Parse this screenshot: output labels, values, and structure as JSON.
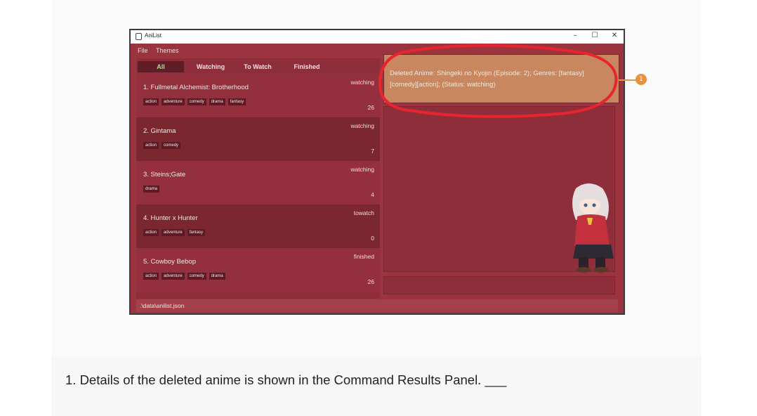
{
  "window": {
    "title": "AniList",
    "minimize": "–",
    "maximize": "☐",
    "close": "✕"
  },
  "menu": {
    "file": "File",
    "themes": "Themes"
  },
  "tabs": [
    {
      "label": "All",
      "active": true
    },
    {
      "label": "Watching",
      "active": false
    },
    {
      "label": "To Watch",
      "active": false
    },
    {
      "label": "Finished",
      "active": false
    }
  ],
  "anime_list": [
    {
      "name": "1.  Fullmetal Alchemist: Brotherhood",
      "tags": [
        "action",
        "adventure",
        "comedy",
        "drama",
        "fantasy"
      ],
      "status": "watching",
      "episode": "26"
    },
    {
      "name": "2.  Gintama",
      "tags": [
        "action",
        "comedy"
      ],
      "status": "watching",
      "episode": "7"
    },
    {
      "name": "3.  Steins;Gate",
      "tags": [
        "drama"
      ],
      "status": "watching",
      "episode": "4"
    },
    {
      "name": "4.  Hunter x Hunter",
      "tags": [
        "action",
        "adventure",
        "fantasy"
      ],
      "status": "towatch",
      "episode": "0"
    },
    {
      "name": "5.  Cowboy Bebop",
      "tags": [
        "action",
        "adventure",
        "comedy",
        "drama"
      ],
      "status": "finished",
      "episode": "26"
    }
  ],
  "result": {
    "text": "Deleted Anime: Shingeki no Kyojin (Episode: 2); Genres: [fantasy][comedy][action]; (Status: watching)"
  },
  "statusbar": {
    "path": ".\\data\\anilist.json"
  },
  "callout": {
    "number": "1"
  },
  "caption": {
    "text": "1. Details of the deleted anime is shown in the Command Results Panel. ___"
  },
  "colors": {
    "accent": "#9c3440",
    "highlight": "#e8242e",
    "result_bg": "#c98760",
    "badge": "#e8913f"
  }
}
